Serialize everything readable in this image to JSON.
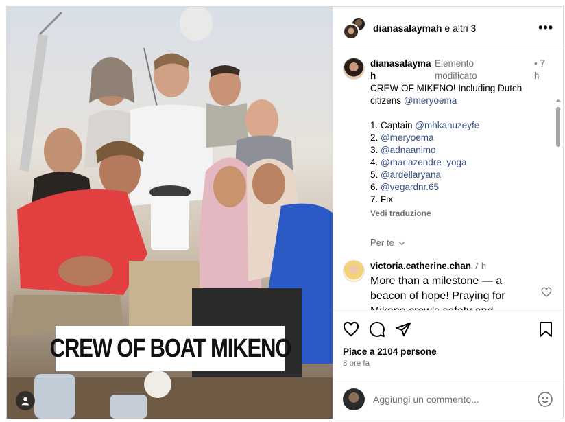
{
  "photo": {
    "banner_text": "CREW OF BOAT MIKENO"
  },
  "header": {
    "username": "dianasalaymah",
    "suffix": "e altri 3"
  },
  "caption": {
    "username": "dianasalaymah",
    "edited": "Elemento modificato",
    "time": "• 7 h",
    "lines": [
      "CREW OF MIKENO! Including Dutch citizens",
      "@meryoema",
      "1. Captain ",
      "@mhkahuzeyfe",
      "2. ",
      "@meryoema",
      "3. ",
      "@adnaanimo",
      "4. ",
      "@mariazendre_yoga",
      "5. ",
      "@ardellaryana",
      "6. ",
      "@vegardnr.65",
      "7. Fix"
    ],
    "translate": "Vedi traduzione"
  },
  "per_te": "Per te",
  "comment": {
    "username": "victoria.catherine.chan",
    "time": "7 h",
    "text": "More than a milestone — a beacon of hope! Praying for Mikeno crew’s safety and"
  },
  "likes": "Piace a 2104 persone",
  "ago": "8 ore fa",
  "add_comment_placeholder": "Aggiungi un commento...",
  "icons": {
    "more": "more-icon",
    "like": "heart-icon",
    "comment": "comment-icon",
    "share": "share-icon",
    "save": "bookmark-icon",
    "emoji": "emoji-icon",
    "user": "user-tag-icon"
  }
}
